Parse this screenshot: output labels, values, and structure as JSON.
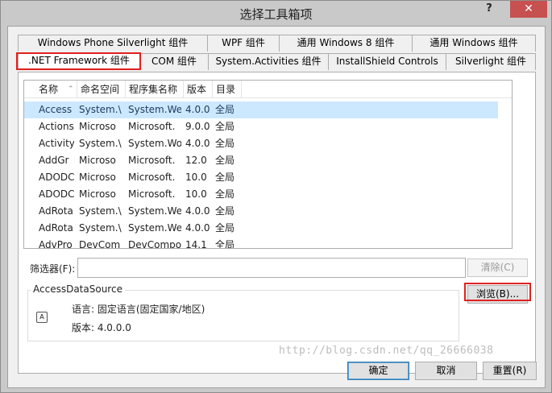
{
  "window": {
    "title": "选择工具箱项",
    "help_glyph": "?",
    "close_glyph": "✕"
  },
  "tabs_row1": [
    {
      "label": "Windows Phone Silverlight 组件"
    },
    {
      "label": "WPF 组件"
    },
    {
      "label": "通用 Windows 8 组件"
    },
    {
      "label": "通用 Windows 组件"
    }
  ],
  "tabs_row2": [
    {
      "label": ".NET Framework 组件",
      "active": true,
      "highlighted": true
    },
    {
      "label": "COM 组件"
    },
    {
      "label": "System.Activities 组件"
    },
    {
      "label": "InstallShield Controls"
    },
    {
      "label": "Silverlight 组件"
    }
  ],
  "list": {
    "columns": [
      "名称",
      "命名空间",
      "程序集名称",
      "版本",
      "目录"
    ],
    "rows": [
      [
        "Access",
        "System.\\",
        "System.We",
        "4.0.0",
        "全局"
      ],
      [
        "Actions",
        "Microso",
        "Microsoft.",
        "9.0.0",
        "全局"
      ],
      [
        "Activity",
        "System.\\",
        "System.Wo",
        "4.0.0",
        "全局"
      ],
      [
        "AddGr",
        "Microso",
        "Microsoft.",
        "12.0",
        "全局"
      ],
      [
        "ADODC",
        "Microso",
        "Microsoft.",
        "10.0",
        "全局"
      ],
      [
        "ADODC",
        "Microso",
        "Microsoft.",
        "10.0",
        "全局"
      ],
      [
        "AdRota",
        "System.\\",
        "System.We",
        "4.0.0",
        "全局"
      ],
      [
        "AdRota",
        "System.\\",
        "System.We",
        "4.0.0",
        "全局"
      ],
      [
        "AdvPro",
        "DevCom",
        "DevCompo",
        "14.1",
        "全局"
      ]
    ],
    "selected_index": 0
  },
  "filter": {
    "label": "筛选器(F):",
    "value": "",
    "clear_label": "清除(C)"
  },
  "details": {
    "group_title": "AccessDataSource",
    "icon_name": "component-icon",
    "language_line": "语言: 固定语言(固定国家/地区)",
    "version_line": "版本: 4.0.0.0",
    "browse_label": "浏览(B)..."
  },
  "footer": {
    "ok_label": "确定",
    "cancel_label": "取消",
    "reset_label": "重置(R)"
  },
  "watermark": "http://blog.csdn.net/qq_26666038",
  "colors": {
    "highlight_border": "#e02020",
    "selection": "#cce8ff",
    "close_button": "#c75050"
  }
}
